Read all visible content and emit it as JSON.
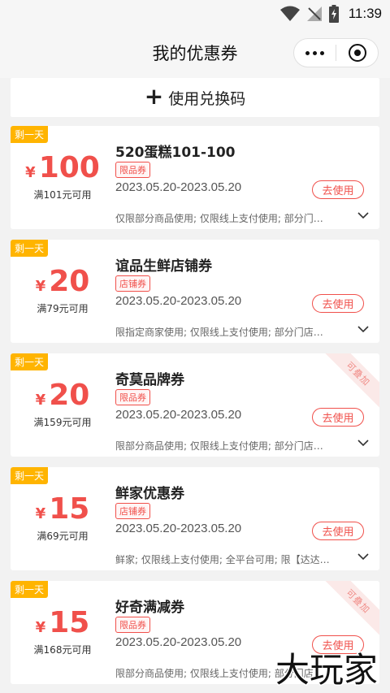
{
  "status_bar": {
    "time": "11:39"
  },
  "nav": {
    "title": "我的优惠券"
  },
  "redeem": {
    "icon": "+",
    "label": "使用兑换码"
  },
  "coupons": [
    {
      "badge": "剩一天",
      "currency": "¥",
      "amount": "100",
      "min_spend": "满101元可用",
      "title": "520蛋糕101-100",
      "tag": "限品券",
      "date_range": "2023.05.20-2023.05.20",
      "button": "去使用",
      "desc": "仅限部分商品使用; 仅限线上支付使用; 部分门…",
      "stackable": ""
    },
    {
      "badge": "剩一天",
      "currency": "¥",
      "amount": "20",
      "min_spend": "满79元可用",
      "title": "谊品生鲜店铺券",
      "tag": "店铺券",
      "date_range": "2023.05.20-2023.05.20",
      "button": "去使用",
      "desc": "限指定商家使用; 仅限线上支付使用; 部分门店…",
      "stackable": ""
    },
    {
      "badge": "剩一天",
      "currency": "¥",
      "amount": "20",
      "min_spend": "满159元可用",
      "title": "奇莫品牌券",
      "tag": "限品券",
      "date_range": "2023.05.20-2023.05.20",
      "button": "去使用",
      "desc": "限部分商品使用; 仅限线上支付使用; 部分门店…",
      "stackable": "可叠加"
    },
    {
      "badge": "剩一天",
      "currency": "¥",
      "amount": "15",
      "min_spend": "满69元可用",
      "title": "鲜家优惠券",
      "tag": "店铺券",
      "date_range": "2023.05.20-2023.05.20",
      "button": "去使用",
      "desc": "鲜家; 仅限线上支付使用; 全平台可用; 限【达达…",
      "stackable": ""
    },
    {
      "badge": "剩一天",
      "currency": "¥",
      "amount": "15",
      "min_spend": "满168元可用",
      "title": "好奇满减券",
      "tag": "限品券",
      "date_range": "2023.05.20-2023.05.20",
      "button": "去使用",
      "desc": "限部分商品使用; 仅限线上支付使用; 部分门店…",
      "stackable": "可叠加"
    }
  ],
  "watermark": {
    "text": "大玩家"
  },
  "colors": {
    "accent": "#f0504b",
    "badge": "#ffb400",
    "background": "#f2f2f2"
  },
  "icons": [
    "wifi-icon",
    "signal-icon",
    "battery-icon",
    "more-icon",
    "close-circle-icon",
    "plus-icon",
    "chevron-down-icon"
  ]
}
